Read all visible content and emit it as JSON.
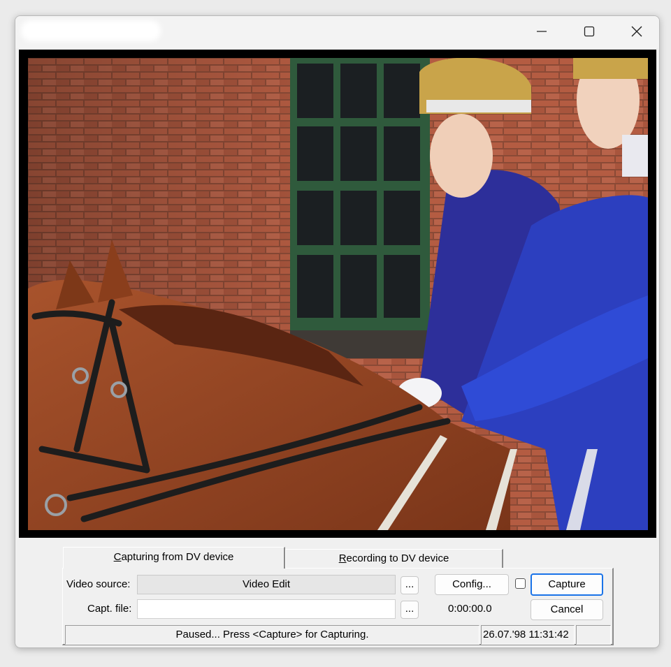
{
  "window": {
    "title": ""
  },
  "titlebar": {
    "minimize_icon": "minimize-icon",
    "maximize_icon": "maximize-icon",
    "close_icon": "close-icon"
  },
  "video": {
    "description_icon": "video-preview"
  },
  "tabs": [
    {
      "label": "Capturing from DV device",
      "accel": "C",
      "rest": "apturing from DV device",
      "active": true
    },
    {
      "label": "Recording to DV device",
      "accel": "R",
      "rest": "ecording to DV device",
      "active": false
    }
  ],
  "form": {
    "video_source_label": "Video source:",
    "video_source_value": "Video Edit",
    "capt_file_label": "Capt. file:",
    "capt_file_value": "",
    "browse_label": "...",
    "config_label": "Config...",
    "timecode": "0:00:00.0",
    "capture_label": "Capture",
    "cancel_label": "Cancel",
    "checkbox_checked": false
  },
  "status": {
    "message": "Paused... Press <Capture> for Capturing.",
    "datetime": "26.07.'98 11:31:42",
    "extra": ""
  },
  "colors": {
    "accent": "#1a73e8",
    "window_bg": "#f0f0f0"
  }
}
